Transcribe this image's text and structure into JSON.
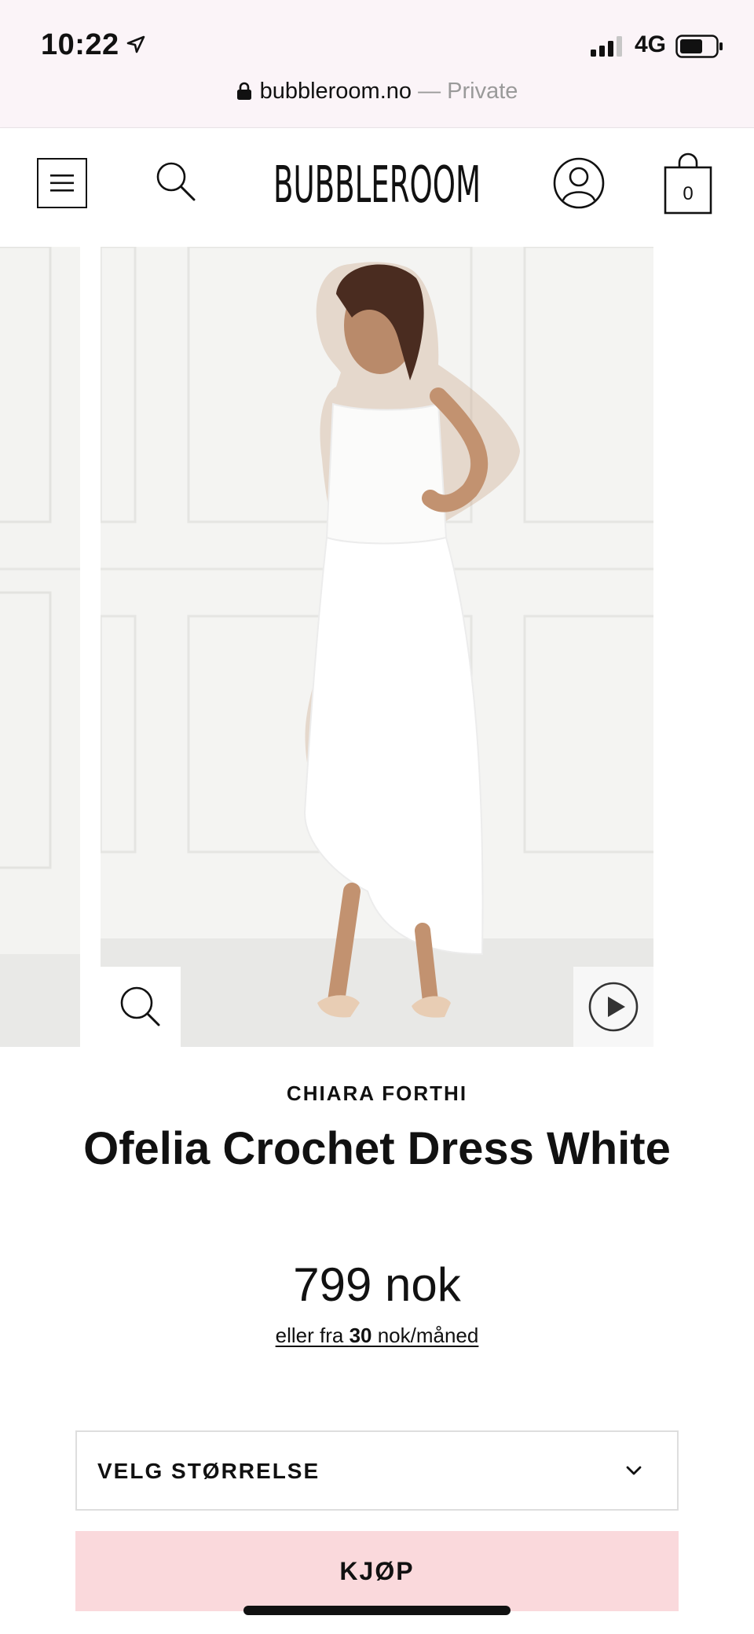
{
  "status_bar": {
    "time": "10:22",
    "network": "4G",
    "icons": [
      "location-arrow-icon",
      "signal-icon",
      "battery-icon"
    ]
  },
  "url_bar": {
    "domain": "bubbleroom.no",
    "mode": " — Private",
    "icon": "lock-icon"
  },
  "header": {
    "logo_text": "BUBBLEROOM",
    "cart_count": "0",
    "icons": [
      "menu-icon",
      "search-icon",
      "account-icon",
      "shopping-bag-icon"
    ]
  },
  "gallery": {
    "icons": [
      "zoom-icon",
      "play-icon"
    ]
  },
  "product": {
    "brand": "CHIARA FORTHI",
    "title": "Ofelia Crochet Dress White",
    "price": "799 nok",
    "installment_prefix": "eller fra ",
    "installment_amount": "30",
    "installment_suffix": " nok/måned"
  },
  "size_select": {
    "label": "VELG STØRRELSE",
    "icon": "chevron-down-icon"
  },
  "buy_button": {
    "label": "KJØP"
  },
  "colors": {
    "status_bg": "#fbf4f8",
    "buy_button_bg": "#fad9dc",
    "text": "#111111"
  }
}
